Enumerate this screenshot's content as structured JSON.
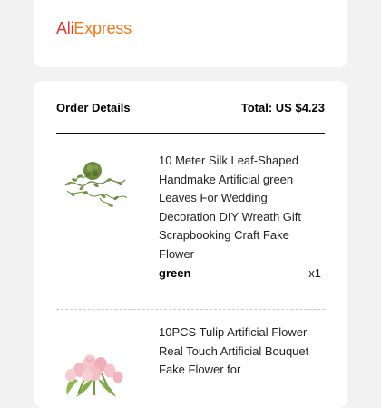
{
  "brand": {
    "part1": "Ali",
    "part2": "Express",
    "color_red": "#e8352d",
    "color_orange": "#f07a1a"
  },
  "order": {
    "title": "Order Details",
    "total": "Total: US $4.23"
  },
  "items": [
    {
      "title": "10 Meter Silk Leaf-Shaped Handmake Artificial green Leaves For Wedding Decoration DIY Wreath Gift Scrapbooking Craft Fake Flower",
      "color": "green",
      "qty": "x1",
      "image": "leaf-garland-image"
    },
    {
      "title": "10PCS Tulip Artificial Flower Real Touch Artificial Bouquet Fake Flower for",
      "image": "tulip-bouquet-image"
    }
  ]
}
